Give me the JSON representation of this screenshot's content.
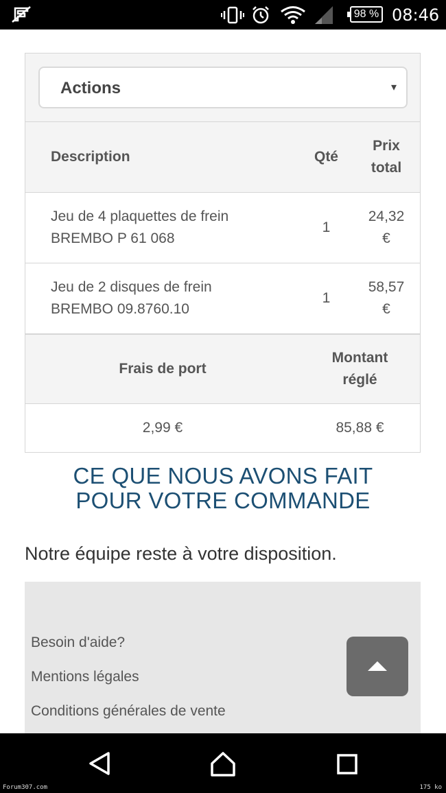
{
  "status_bar": {
    "battery": "98 %",
    "time": "08:46",
    "icons": [
      "no-sim-icon",
      "vibrate-icon",
      "alarm-icon",
      "wifi-icon",
      "signal-icon",
      "battery-icon"
    ]
  },
  "actions_select": {
    "label": "Actions",
    "caret": "▾"
  },
  "order_table": {
    "headers": {
      "description": "Description",
      "qty": "Qté",
      "price_line1": "Prix",
      "price_line2": "total"
    },
    "rows": [
      {
        "desc_line1": "Jeu de 4 plaquettes de frein",
        "desc_line2": "BREMBO P 61 068",
        "qty": "1",
        "price_line1": "24,32",
        "price_line2": "€"
      },
      {
        "desc_line1": "Jeu de 2 disques de frein",
        "desc_line2": "BREMBO 09.8760.10",
        "qty": "1",
        "price_line1": "58,57",
        "price_line2": "€"
      }
    ]
  },
  "totals": {
    "shipping_label": "Frais de port",
    "paid_label_line1": "Montant",
    "paid_label_line2": "réglé",
    "shipping_value": "2,99 €",
    "paid_value": "85,88 €"
  },
  "section_heading": {
    "line1": "CE QUE NOUS AVONS FAIT",
    "line2": "POUR VOTRE COMMANDE"
  },
  "notice": "Notre équipe reste à votre disposition.",
  "footer": {
    "links": [
      "Besoin d'aide?",
      "Mentions légales",
      "Conditions générales de vente"
    ]
  },
  "watermark": {
    "left": "Forum307.com",
    "right": "175 ko"
  },
  "colors": {
    "heading": "#1c4f73",
    "panel_bg": "#f4f4f4",
    "footer_bg": "#e7e7e7",
    "to_top_button": "#6b6b6b"
  }
}
